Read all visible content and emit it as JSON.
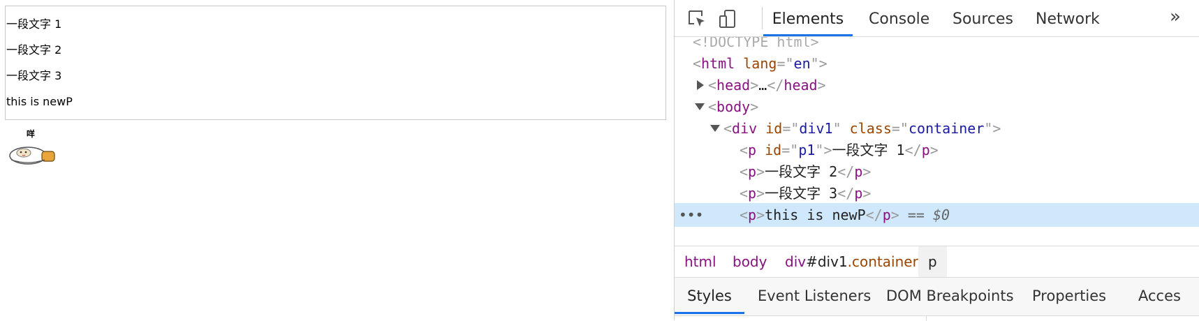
{
  "page": {
    "paragraphs": [
      "一段文字 1",
      "一段文字 2",
      "一段文字 3",
      "this is newP"
    ],
    "gif_caption": "咩"
  },
  "devtools": {
    "toolbar": {
      "inspect_icon": "inspect-element-icon",
      "device_icon": "device-toolbar-icon",
      "tabs": [
        "Elements",
        "Console",
        "Sources",
        "Network"
      ],
      "active_tab": "Elements",
      "more_label": "»"
    },
    "tree": {
      "doctype": "<!DOCTYPE html>",
      "html_tag": "html",
      "html_attr_name": "lang",
      "html_attr_value": "en",
      "head_tag": "head",
      "head_ellipsis": "…",
      "body_tag": "body",
      "div_tag": "div",
      "div_id_name": "id",
      "div_id_value": "div1",
      "div_class_name": "class",
      "div_class_value": "container",
      "p_tag": "p",
      "p1_id_name": "id",
      "p1_id_value": "p1",
      "p_texts": [
        "一段文字 1",
        "一段文字 2",
        "一段文字 3",
        "this is newP"
      ],
      "selected_marker": "== $0",
      "row_dots": "•••"
    },
    "breadcrumb": {
      "html": "html",
      "body": "body",
      "div_tag": "div",
      "div_id": "#div1",
      "div_class": ".container",
      "p": "p"
    },
    "subtabs": {
      "items": [
        "Styles",
        "Event Listeners",
        "DOM Breakpoints",
        "Properties",
        "Acces"
      ],
      "active": "Styles"
    }
  }
}
